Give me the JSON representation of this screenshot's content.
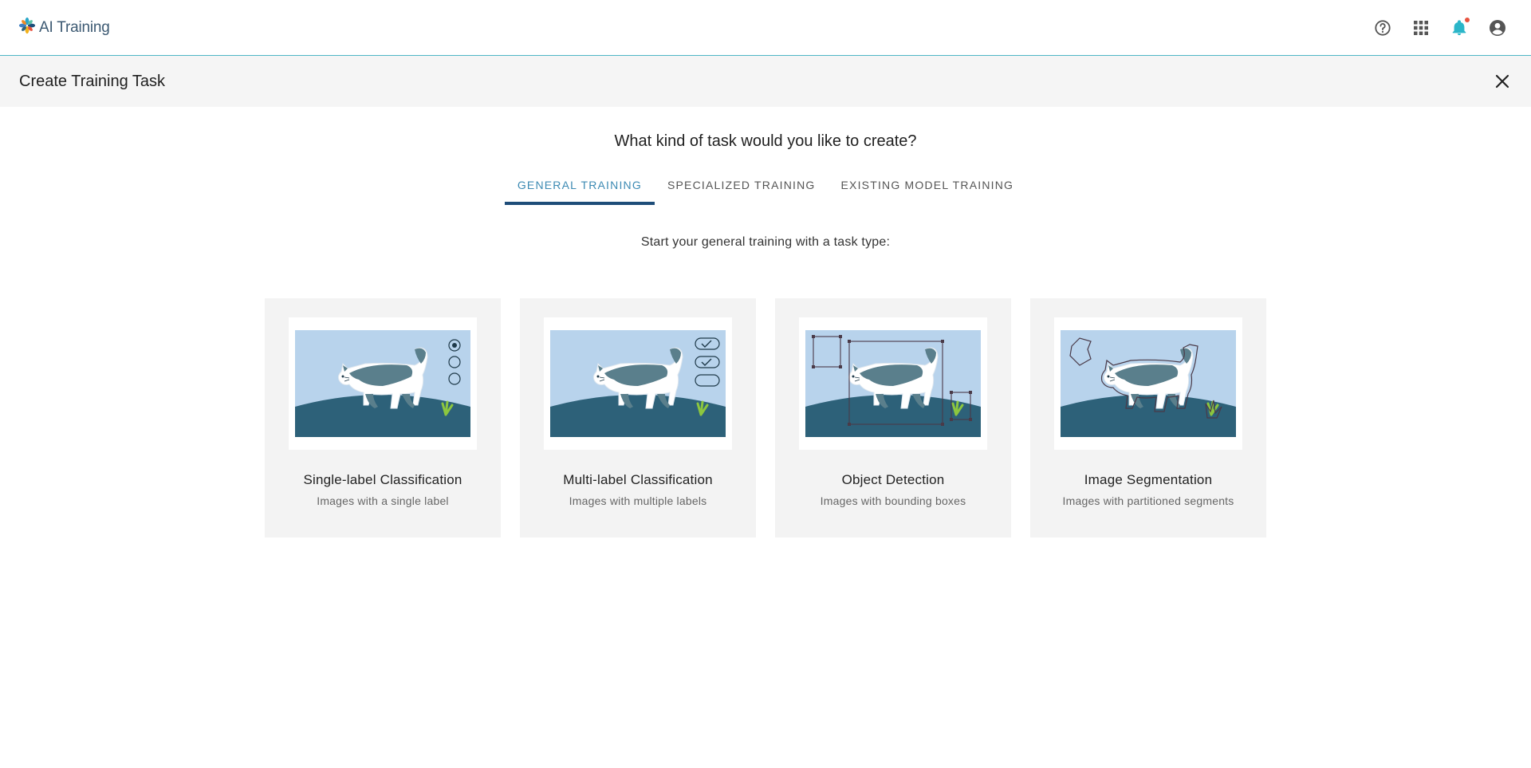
{
  "app": {
    "name": "AI Training"
  },
  "topbar": {
    "icons": [
      "help-icon",
      "apps-grid-icon",
      "notification-bell-icon",
      "account-icon"
    ],
    "notification_dot_color": "#e8533f",
    "bell_color": "#2bb6c9"
  },
  "header": {
    "title": "Create Training Task"
  },
  "main": {
    "question": "What kind of task would you like to create?",
    "tabs": [
      {
        "label": "GENERAL TRAINING",
        "active": true
      },
      {
        "label": "SPECIALIZED TRAINING",
        "active": false
      },
      {
        "label": "EXISTING MODEL TRAINING",
        "active": false
      }
    ],
    "subtitle": "Start your general training with a task type:",
    "cards": [
      {
        "title": "Single-label Classification",
        "description": "Images with a single label"
      },
      {
        "title": "Multi-label Classification",
        "description": "Images with multiple labels"
      },
      {
        "title": "Object Detection",
        "description": "Images with bounding boxes"
      },
      {
        "title": "Image Segmentation",
        "description": "Images with partitioned segments"
      }
    ]
  },
  "colors": {
    "accent": "#3c8ab3",
    "tab_underline": "#1e4d79",
    "sky": "#b8d3ec",
    "hill": "#2d6179",
    "cat_patch": "#5a7f8c"
  }
}
